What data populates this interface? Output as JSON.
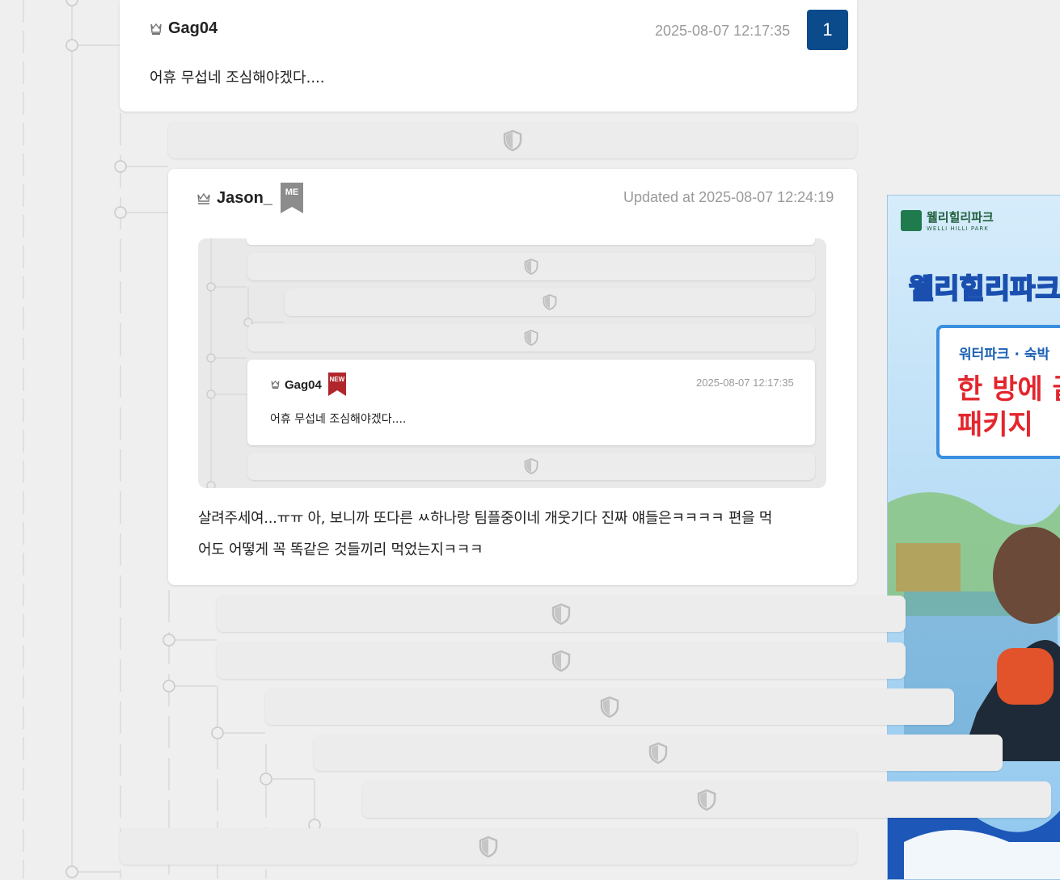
{
  "comments": {
    "top": {
      "author": "Gag04",
      "timestamp": "2025-08-07 12:17:35",
      "count_badge": "1",
      "text": "어휴 무섭네 조심해야겠다...."
    },
    "jason": {
      "author": "Jason_",
      "me_badge": "ME",
      "timestamp": "Updated at 2025-08-07 12:24:19",
      "text_line1": "살려주세여...ㅠㅠ 아, 보니까 또다른 ㅆ하나랑 팀플중이네 개웃기다 진짜 얘들은ㅋㅋㅋㅋ 편을 먹",
      "text_line2": "어도 어떻게 꼭 똑같은 것들끼리 먹었는지ㅋㅋㅋ"
    },
    "embedded": {
      "author": "Gag04",
      "new_badge": "NEW",
      "timestamp": "2025-08-07 12:17:35",
      "text": "어휴 무섭네 조심해야겠다...."
    }
  },
  "ad": {
    "brand": "웰리힐리파크",
    "brand_sub": "WELLI HILLI PARK",
    "headline": "웰리힐리파크",
    "tagline": "워터파크 · 숙박",
    "promo_line1": "한 방에 끝",
    "promo_line2": "패키지"
  },
  "icons": {
    "shield": "shield-icon",
    "crown": "crown-icon",
    "crown_outline": "crown-outline-icon"
  },
  "colors": {
    "badge_blue": "#0b4a8b",
    "me_gray": "#8c8c8c",
    "new_red": "#b0262c",
    "ad_red": "#e3262e",
    "ad_blue": "#1a5fb4"
  }
}
